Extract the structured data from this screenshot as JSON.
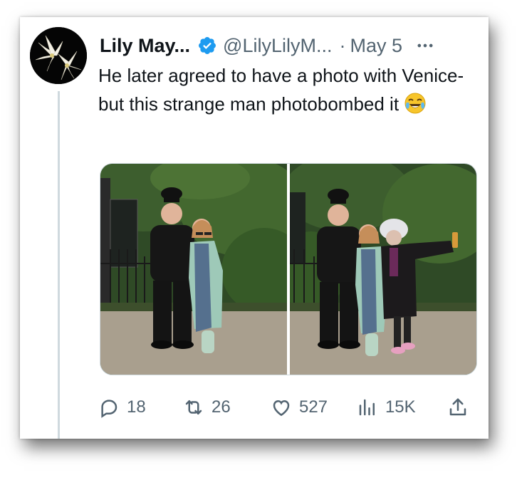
{
  "tweet": {
    "display_name": "Lily May...",
    "handle": "@LilyLilyM...",
    "separator": "·",
    "date": "May 5",
    "text": "He later agreed to have a photo with Venice- but this strange man photobombed it",
    "emoji": "😂"
  },
  "stats": {
    "replies": "18",
    "reposts": "26",
    "likes": "527",
    "views": "15K"
  },
  "colors": {
    "text_primary": "#0f1419",
    "text_secondary": "#536471",
    "verified_badge": "#1d9bf0",
    "thread_line": "#cfd9de"
  },
  "icons": [
    "lily-flower-avatar",
    "verified-badge-icon",
    "more-icon",
    "reply-icon",
    "repost-icon",
    "like-icon",
    "views-icon",
    "share-icon",
    "laughing-tears-emoji"
  ]
}
